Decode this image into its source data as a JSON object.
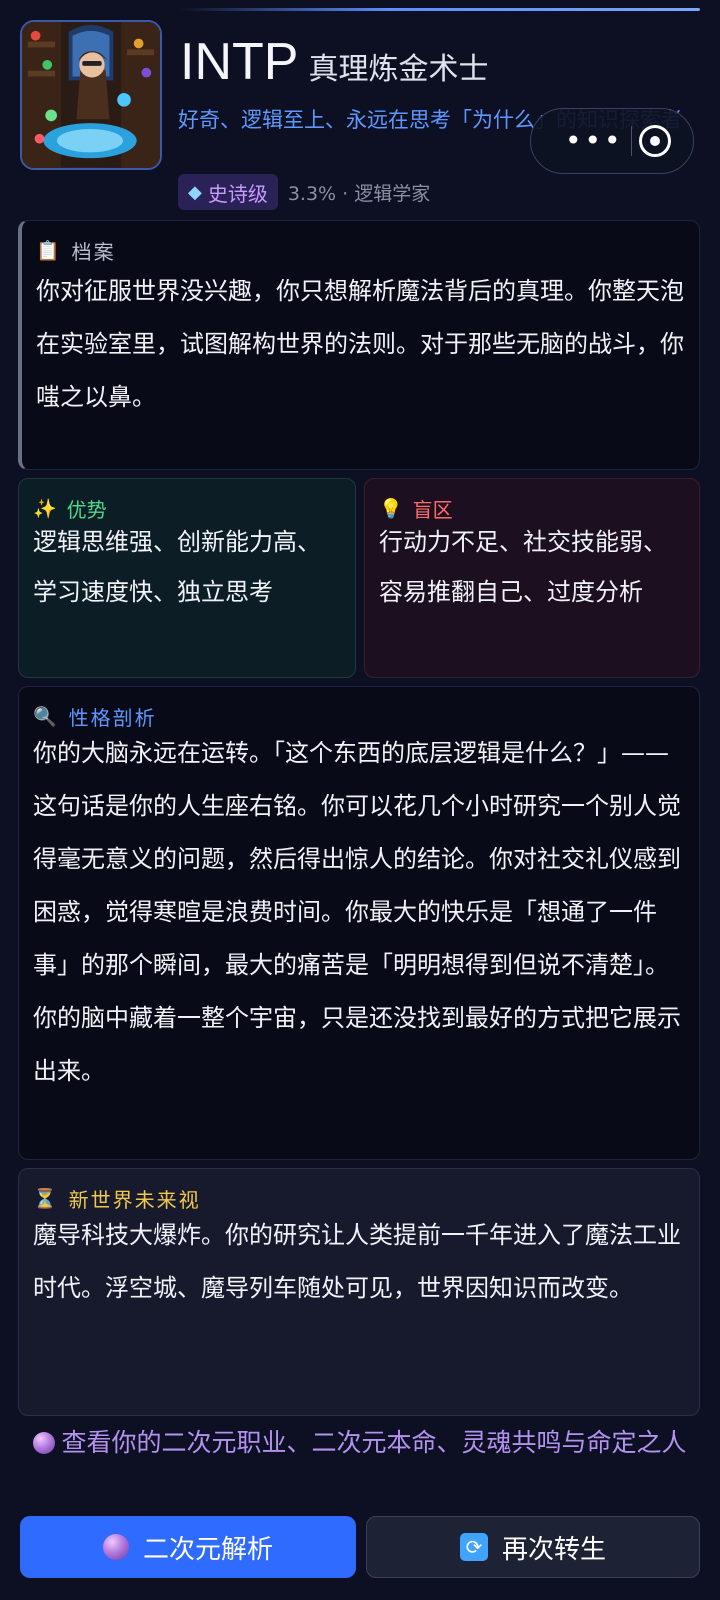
{
  "header": {
    "title": "INTP",
    "subtitle": "真理炼金术士",
    "tagline": "好奇、逻辑至上、永远在思考「为什么」的知识探索者",
    "rarity_label": "史诗级",
    "rarity_meta": "3.3% · 逻辑学家"
  },
  "archive": {
    "title": "档案",
    "body": "你对征服世界没兴趣，你只想解析魔法背后的真理。你整天泡在实验室里，试图解构世界的法则。对于那些无脑的战斗，你嗤之以鼻。"
  },
  "strength": {
    "title": "优势",
    "body": "逻辑思维强、创新能力高、学习速度快、独立思考"
  },
  "blindspot": {
    "title": "盲区",
    "body": "行动力不足、社交技能弱、容易推翻自己、过度分析"
  },
  "analysis": {
    "title": "性格剖析",
    "body": "你的大脑永远在运转。「这个东西的底层逻辑是什么？」——这句话是你的人生座右铭。你可以花几个小时研究一个别人觉得毫无意义的问题，然后得出惊人的结论。你对社交礼仪感到困惑，觉得寒暄是浪费时间。你最大的快乐是「想通了一件事」的那个瞬间，最大的痛苦是「明明想得到但说不清楚」。你的脑中藏着一整个宇宙，只是还没找到最好的方式把它展示出来。"
  },
  "future": {
    "title": "新世界未来视",
    "body": "魔导科技大爆炸。你的研究让人类提前一千年进入了魔法工业时代。浮空城、魔导列车随处可见，世界因知识而改变。"
  },
  "cta": {
    "text": "查看你的二次元职业、二次元本命、灵魂共鸣与命定之人"
  },
  "buttons": {
    "primary": "二次元解析",
    "secondary": "再次转生"
  },
  "icons": {
    "archive": "clipboard-icon",
    "strength": "sparkles-icon",
    "blindspot": "lightbulb-icon",
    "analysis": "magnifier-icon",
    "future": "hourglass-icon",
    "rarity": "gem-icon",
    "cta": "crystal-ball-icon",
    "reroll": "refresh-icon"
  },
  "colors": {
    "background": "#0c1022",
    "accent_blue": "#2f6bff",
    "tagline_blue": "#5e98ff",
    "strength_green": "#4cd98a",
    "blindspot_red": "#ff6b6b",
    "future_gold": "#f2c84b",
    "rarity_purple": "#c79bff",
    "cta_purple": "#b392f0"
  }
}
